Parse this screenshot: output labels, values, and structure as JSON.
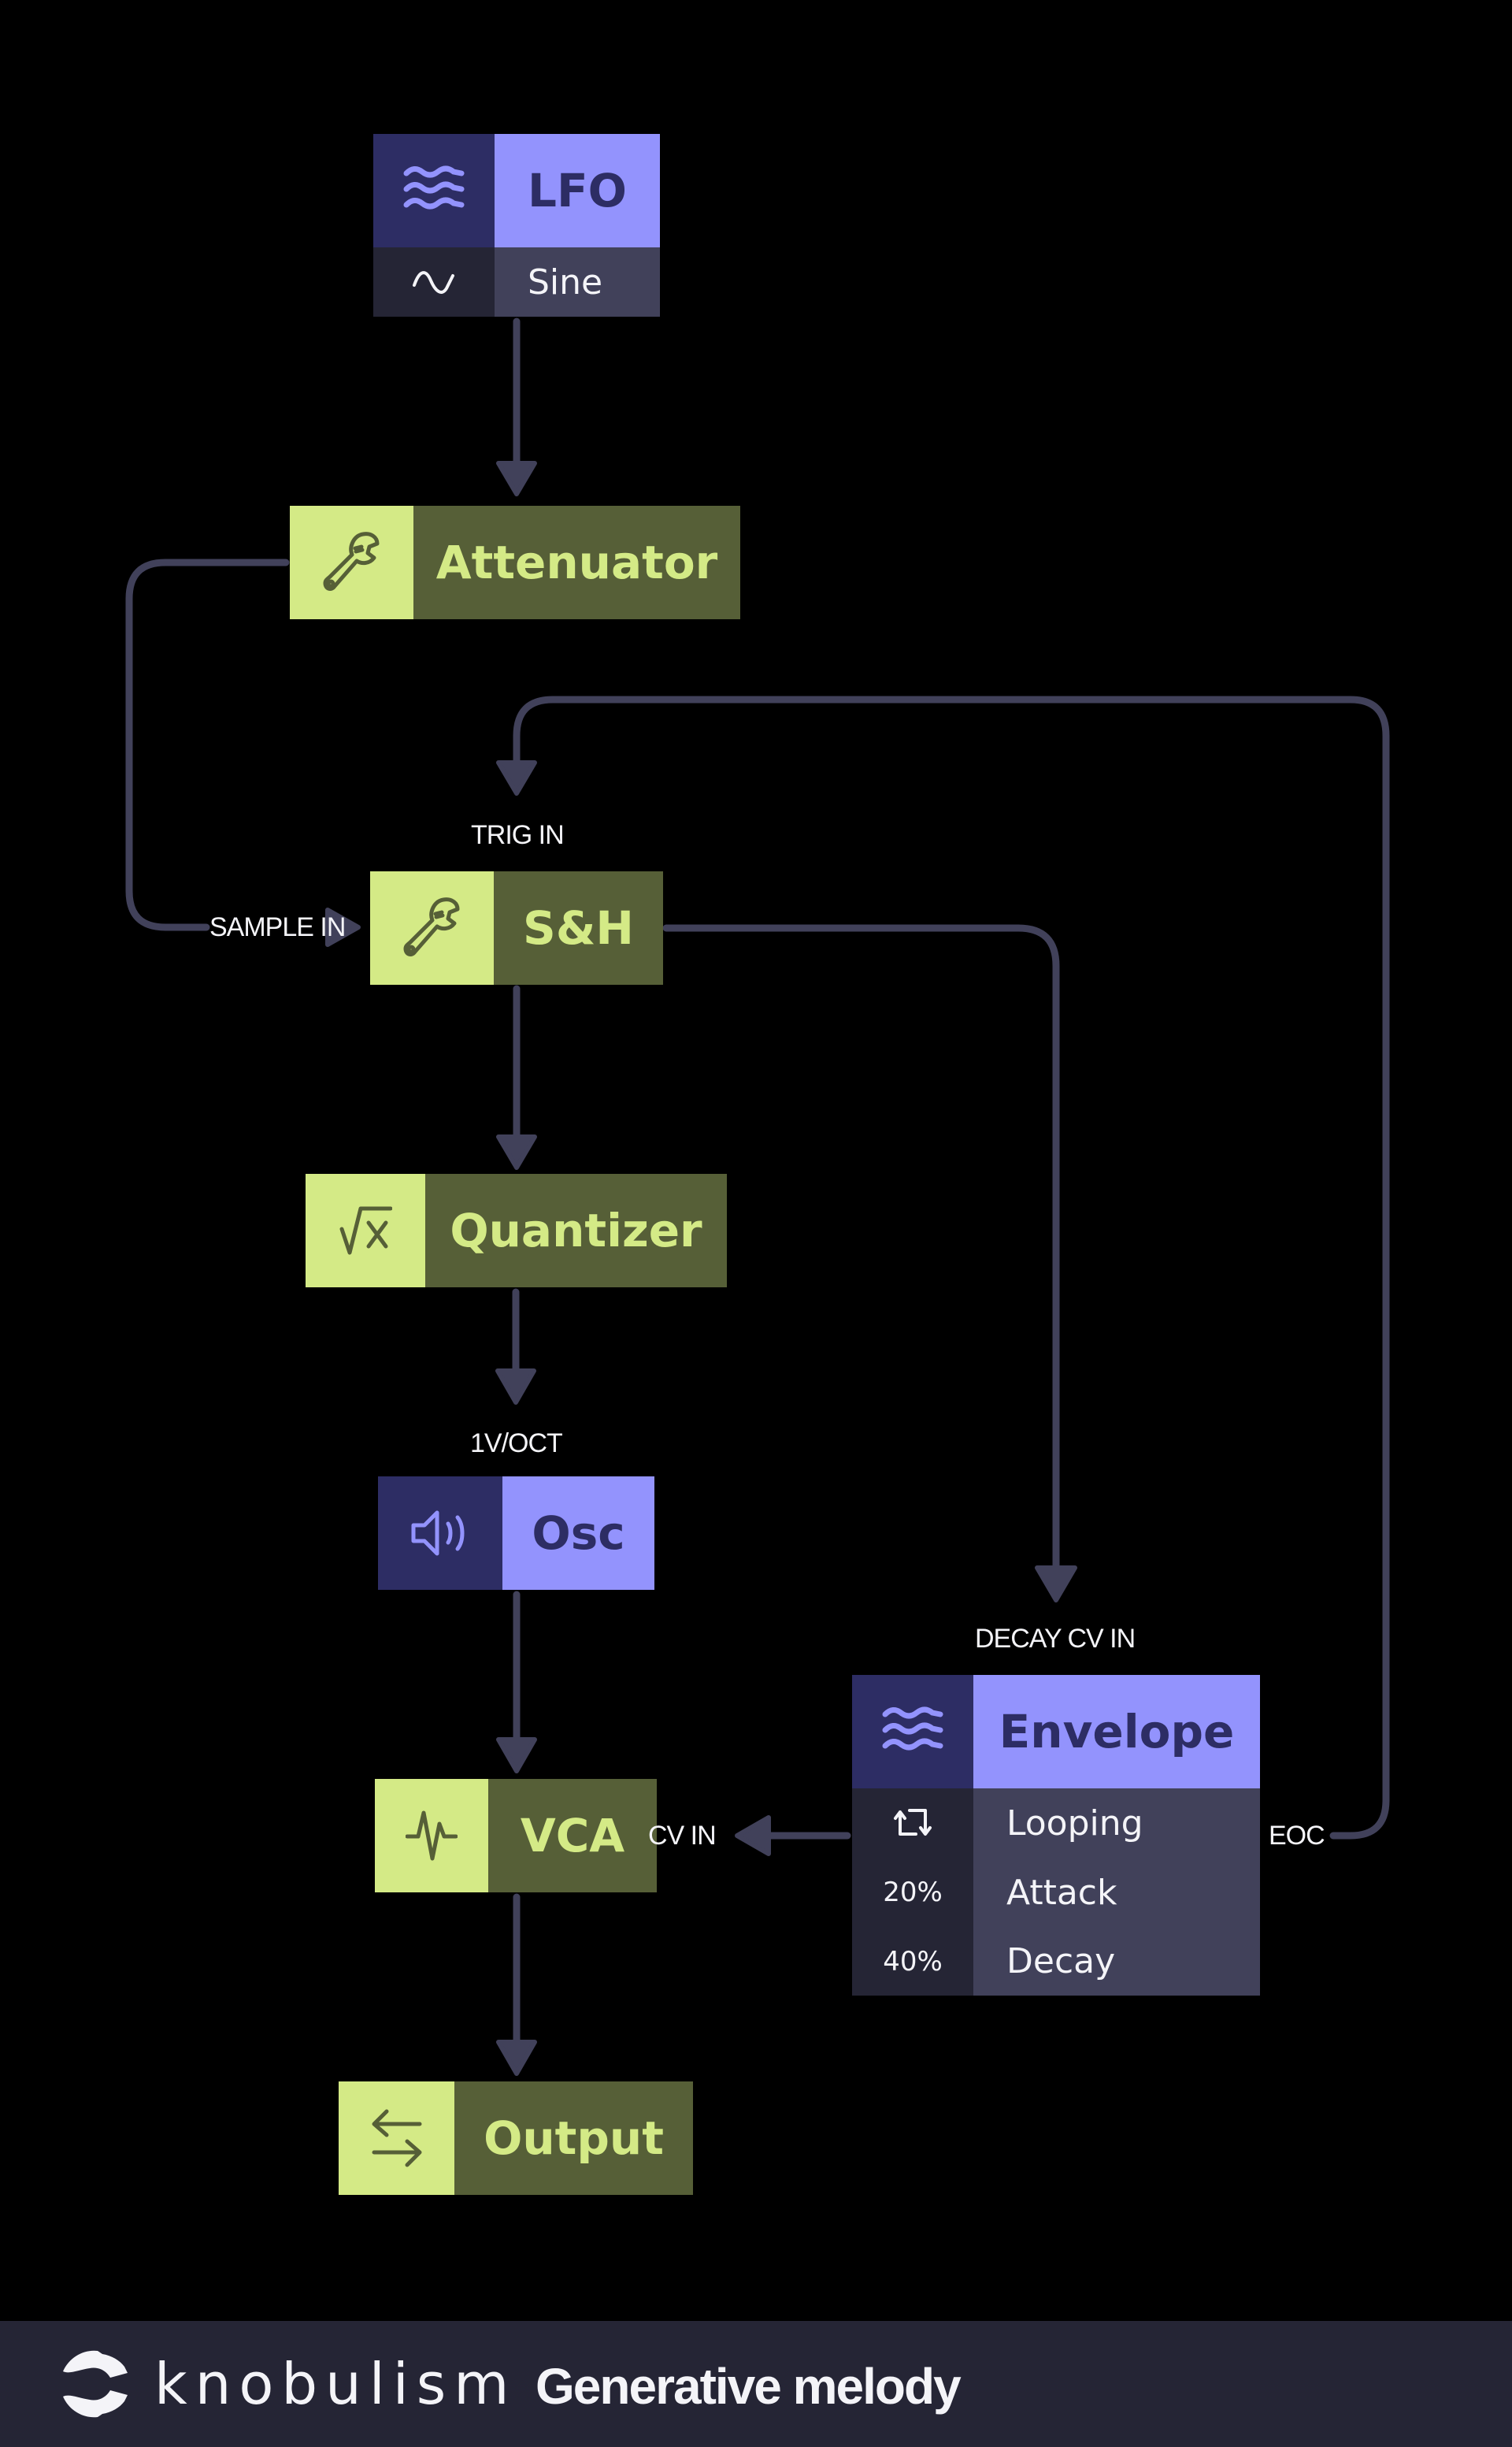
{
  "diagram": {
    "title": "Generative melody",
    "modules": {
      "lfo": {
        "title": "LFO",
        "icon": "waves-icon",
        "param": {
          "icon": "sine-wave-icon",
          "label": "Sine"
        }
      },
      "attenuator": {
        "title": "Attenuator",
        "icon": "wrench-icon"
      },
      "sample_hold": {
        "title": "S&H",
        "icon": "wrench-icon"
      },
      "quantizer": {
        "title": "Quantizer",
        "icon": "square-root-icon"
      },
      "osc": {
        "title": "Osc",
        "icon": "speaker-icon"
      },
      "vca": {
        "title": "VCA",
        "icon": "pulse-icon"
      },
      "output": {
        "title": "Output",
        "icon": "swap-arrows-icon"
      },
      "envelope": {
        "title": "Envelope",
        "icon": "waves-icon",
        "params": [
          {
            "value": "",
            "icon": "loop-icon",
            "label": "Looping"
          },
          {
            "value": "20%",
            "label": "Attack"
          },
          {
            "value": "40%",
            "label": "Decay"
          }
        ]
      }
    },
    "ports": {
      "trig_in": "TRIG IN",
      "sample_in": "SAMPLE IN",
      "v_oct": "1V/OCT",
      "decay_cv_in": "DECAY CV IN",
      "cv_in": "CV IN",
      "eoc": "EOC"
    },
    "connections": [
      {
        "from": "LFO",
        "to": "Attenuator"
      },
      {
        "from": "Attenuator",
        "to": "S&H",
        "port": "SAMPLE IN"
      },
      {
        "from": "Envelope",
        "fromPort": "EOC",
        "to": "S&H",
        "port": "TRIG IN"
      },
      {
        "from": "S&H",
        "to": "Quantizer"
      },
      {
        "from": "S&H",
        "to": "Envelope",
        "port": "DECAY CV IN"
      },
      {
        "from": "Quantizer",
        "to": "Osc",
        "port": "1V/OCT"
      },
      {
        "from": "Osc",
        "to": "VCA"
      },
      {
        "from": "Envelope",
        "to": "VCA",
        "port": "CV IN"
      },
      {
        "from": "VCA",
        "to": "Output"
      }
    ]
  },
  "footer": {
    "brand": "knobulism",
    "subtitle": "Generative melody",
    "logo": "knobulism-logo-icon"
  },
  "colors": {
    "background": "#000000",
    "wire": "#41415a",
    "green_light": "#d4ea86",
    "green_dark": "#565f37",
    "purple_light": "#9393fd",
    "purple_dark": "#2d2d64",
    "param_bg": "#41415a",
    "param_icon_bg": "#252535",
    "footer_bg": "#252535",
    "text": "#f4f4f8"
  }
}
